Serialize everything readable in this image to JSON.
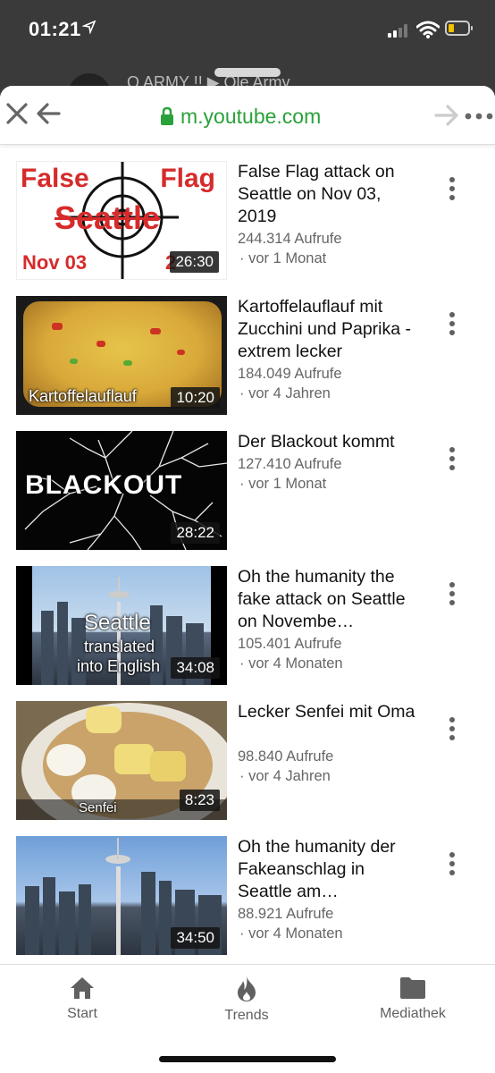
{
  "status": {
    "time": "01:21"
  },
  "behind_text": "Q ARMY !! ▶ Ole Army",
  "browser": {
    "url": "m.youtube.com"
  },
  "videos": [
    {
      "title": "False Flag attack on Seattle on Nov 03, 2019",
      "views": "244.314 Aufrufe",
      "ago": "· vor 1 Monat",
      "duration": "26:30",
      "thumb_text": {
        "left": "False",
        "right": "Flag",
        "center": "Seattle",
        "bottom_left": "Nov 03",
        "bottom_right": "2"
      }
    },
    {
      "title": "Kartoffelauflauf mit Zucchini und Paprika - extrem lecker",
      "views": "184.049 Aufrufe",
      "ago": "· vor 4 Jahren",
      "duration": "10:20",
      "thumb_text": {
        "caption": "Kartoffelauflauf"
      }
    },
    {
      "title": "Der Blackout kommt",
      "views": "127.410 Aufrufe",
      "ago": "· vor 1 Monat",
      "duration": "28:22",
      "thumb_text": {
        "caption": "BLACKOUT"
      }
    },
    {
      "title": "Oh the humanity the fake attack on Seattle on Novembe…",
      "views": "105.401 Aufrufe",
      "ago": "· vor 4 Monaten",
      "duration": "34:08",
      "thumb_text": {
        "line1": "Seattle",
        "line2": "translated",
        "line3": "into English"
      }
    },
    {
      "title": "Lecker Senfei mit Oma",
      "views": "98.840 Aufrufe",
      "ago": "· vor 4 Jahren",
      "duration": "8:23",
      "thumb_text": {
        "caption": "Senfei"
      }
    },
    {
      "title": "Oh the humanity der Fakeanschlag in Seattle am…",
      "views": "88.921 Aufrufe",
      "ago": "· vor 4 Monaten",
      "duration": "34:50",
      "thumb_text": {}
    }
  ],
  "nav": [
    {
      "label": "Start",
      "icon": "home-icon"
    },
    {
      "label": "Trends",
      "icon": "flame-icon"
    },
    {
      "label": "Mediathek",
      "icon": "folder-icon"
    }
  ],
  "colors": {
    "url_green": "#2aa13a",
    "thumb_red": "#d62b2b",
    "battery": "#f2c200"
  }
}
